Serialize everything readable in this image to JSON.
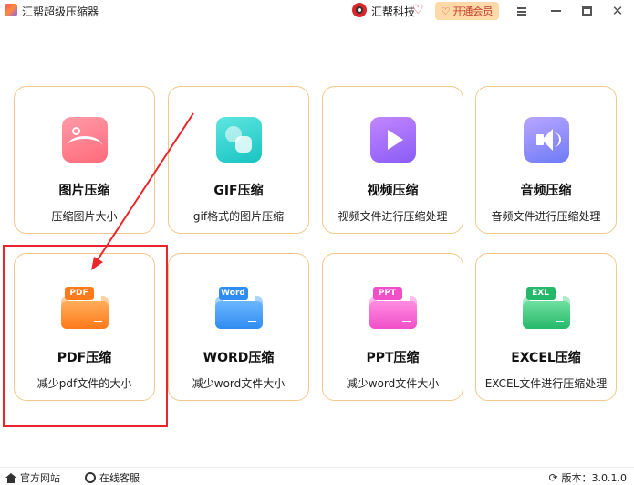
{
  "titlebar": {
    "app_title": "汇帮超级压缩器",
    "brand_name": "汇帮科技",
    "vip_label": "开通会员",
    "icons": [
      "app-logo",
      "brand-logo",
      "heart-icon",
      "menu-icon",
      "minimize-icon",
      "maximize-icon",
      "close-icon"
    ]
  },
  "tools": [
    {
      "title": "图片压缩",
      "desc": "压缩图片大小",
      "icon": "image-icon"
    },
    {
      "title": "GIF压缩",
      "desc": "gif格式的图片压缩",
      "icon": "gif-icon"
    },
    {
      "title": "视频压缩",
      "desc": "视频文件进行压缩处理",
      "icon": "video-play-icon"
    },
    {
      "title": "音频压缩",
      "desc": "音频文件进行压缩处理",
      "icon": "speaker-icon"
    },
    {
      "title": "PDF压缩",
      "desc": "减少pdf文件的大小",
      "icon": "pdf-folder-icon",
      "tag": "PDF"
    },
    {
      "title": "WORD压缩",
      "desc": "减少word文件大小",
      "icon": "word-folder-icon",
      "tag": "Word"
    },
    {
      "title": "PPT压缩",
      "desc": "减少word文件大小",
      "icon": "ppt-folder-icon",
      "tag": "PPT"
    },
    {
      "title": "EXCEL压缩",
      "desc": "EXCEL文件进行压缩处理",
      "icon": "excel-folder-icon",
      "tag": "EXL"
    }
  ],
  "annotation": {
    "color": "#e8262c"
  },
  "footer": {
    "website": "官方网站",
    "service": "在线客服",
    "version": "版本：3.0.1.0"
  },
  "colors": {
    "card_border": "#f2c88a",
    "vip_bg": "#ffd9a8",
    "accent_red": "#e8262c"
  }
}
